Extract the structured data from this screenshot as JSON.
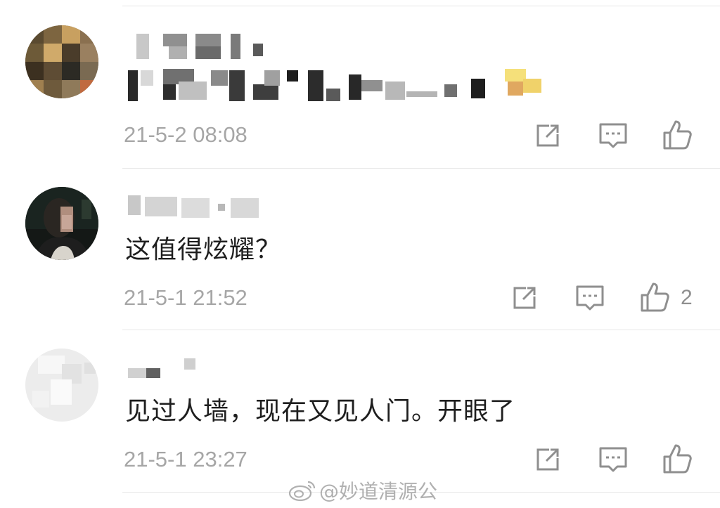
{
  "colors": {
    "background": "#ffffff",
    "text_primary": "#1e1e1e",
    "text_secondary": "#a6a6a6",
    "icon": "#8f8f8f",
    "divider": "#e6e6e6"
  },
  "comments": [
    {
      "username": "",
      "text": "",
      "timestamp": "21-5-2 08:08",
      "like_count": "",
      "icons": [
        "share-icon",
        "reply-icon",
        "like-icon"
      ]
    },
    {
      "username": "",
      "text": "这值得炫耀？",
      "timestamp": "21-5-1 21:52",
      "like_count": "2",
      "icons": [
        "share-icon",
        "reply-icon",
        "like-icon"
      ]
    },
    {
      "username": "",
      "text": "见过人墙，现在又见人门。开眼了",
      "timestamp": "21-5-1 23:27",
      "like_count": "",
      "icons": [
        "share-icon",
        "reply-icon",
        "like-icon"
      ]
    }
  ],
  "watermark": {
    "text": "@妙道清源公",
    "icon": "weibo-logo-icon"
  }
}
